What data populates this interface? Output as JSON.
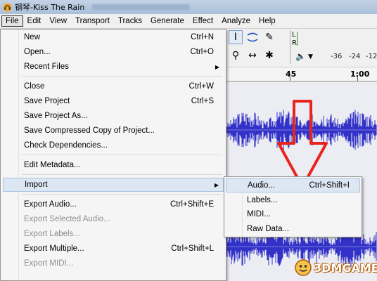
{
  "window": {
    "title": "钢琴-Kiss The Rain"
  },
  "menubar": {
    "items": [
      {
        "label": "File"
      },
      {
        "label": "Edit"
      },
      {
        "label": "View"
      },
      {
        "label": "Transport"
      },
      {
        "label": "Tracks"
      },
      {
        "label": "Generate"
      },
      {
        "label": "Effect"
      },
      {
        "label": "Analyze"
      },
      {
        "label": "Help"
      }
    ]
  },
  "file_menu": {
    "items": [
      {
        "label": "New",
        "shortcut": "Ctrl+N"
      },
      {
        "label": "Open...",
        "shortcut": "Ctrl+O"
      },
      {
        "label": "Recent Files"
      },
      {
        "label": "Close",
        "shortcut": "Ctrl+W"
      },
      {
        "label": "Save Project",
        "shortcut": "Ctrl+S"
      },
      {
        "label": "Save Project As..."
      },
      {
        "label": "Save Compressed Copy of Project..."
      },
      {
        "label": "Check Dependencies..."
      },
      {
        "label": "Edit Metadata..."
      },
      {
        "label": "Import"
      },
      {
        "label": "Export Audio...",
        "shortcut": "Ctrl+Shift+E"
      },
      {
        "label": "Export Selected Audio..."
      },
      {
        "label": "Export Labels..."
      },
      {
        "label": "Export Multiple...",
        "shortcut": "Ctrl+Shift+L"
      },
      {
        "label": "Export MIDI..."
      }
    ]
  },
  "import_submenu": {
    "items": [
      {
        "label": "Audio...",
        "shortcut": "Ctrl+Shift+I"
      },
      {
        "label": "Labels..."
      },
      {
        "label": "MIDI..."
      },
      {
        "label": "Raw Data..."
      }
    ]
  },
  "meter": {
    "left_label": "L",
    "right_label": "R",
    "db_ticks": [
      "-36",
      "-24",
      "-12"
    ]
  },
  "timeline": {
    "ticks": [
      "45",
      "1:00"
    ]
  },
  "watermark": {
    "text": "3DMGAME"
  },
  "colors": {
    "waveform": "#3232c8",
    "arrow": "#e8251c",
    "highlight": "#dde7f3"
  }
}
